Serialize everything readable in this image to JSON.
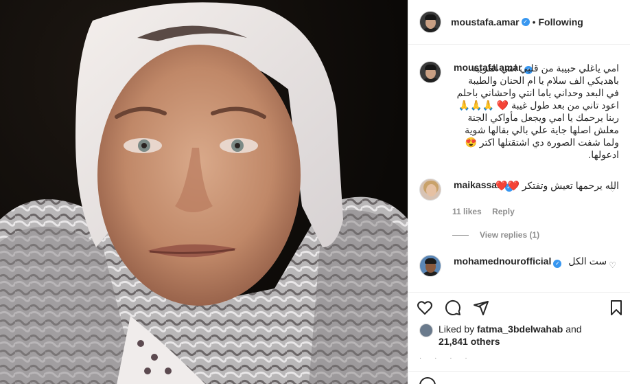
{
  "post": {
    "author": "moustafa.amar",
    "follow_state": "Following",
    "separator": "•",
    "verified_glyph": "✓"
  },
  "caption": {
    "username": "moustafa.amar",
    "text": "امي ياغلي حبيبة من قلبي انتي القريبة باهديكي الف سلام يا ام الحنان والطيبة في البعد وحداني ياما انتي واحشاني باحلم اعود تاني من بعد طول غيبة ❤️ 🙏🙏🙏 ربنا يرحمك يا امي ويجعل مأواكي الجنة معلش اصلها جاية علي بالي بقالها شوية ولما شفت الصورة دي اشتقتلها اكتر 😍 ادعولها."
  },
  "comments": [
    {
      "username": "maikassab",
      "text": "الله يرحمها تعيش وتفتكر ❤️❤️",
      "likes": "11 likes",
      "reply_label": "Reply",
      "view_replies": "View replies (1)"
    },
    {
      "username": "mohamednourofficial",
      "text": "ست الكل"
    }
  ],
  "liked_by": {
    "prefix": "Liked by",
    "user": "fatma_3bdelwahab",
    "and": "and",
    "count": "21,841 others"
  },
  "icons": {
    "like": "heart-icon",
    "comment": "comment-icon",
    "share": "share-icon",
    "save": "bookmark-icon"
  }
}
